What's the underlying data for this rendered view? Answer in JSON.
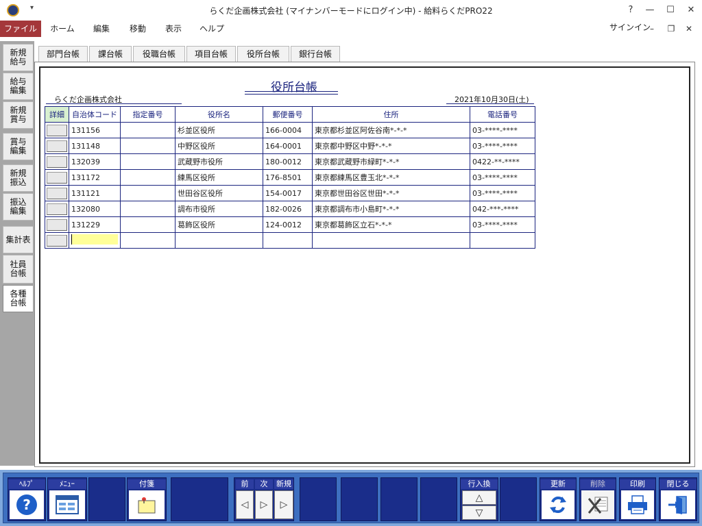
{
  "window": {
    "title": "らくだ企画株式会社 (マイナンバーモードにログイン中) - 給料らくだPRO22",
    "qa_dropdown": "▾",
    "help": "?",
    "minimize": "—",
    "maximize": "☐",
    "close": "✕"
  },
  "menubar": {
    "items": [
      "ファイル",
      "ホーム",
      "編集",
      "移動",
      "表示",
      "ヘルプ"
    ],
    "signin": "サインイン",
    "minimize": "–",
    "restore": "❐",
    "close": "✕"
  },
  "left_tabs": [
    "新規給与",
    "給与編集",
    "新規賞与",
    "賞与編集",
    "新規振込",
    "振込編集",
    "集計表",
    "社員台帳",
    "各種台帳"
  ],
  "top_tabs": [
    "部門台帳",
    "課台帳",
    "役職台帳",
    "項目台帳",
    "役所台帳",
    "銀行台帳"
  ],
  "report": {
    "title": "役所台帳",
    "company": "らくだ企画株式会社",
    "date": "2021年10月30日(土)"
  },
  "table": {
    "headers": [
      "詳細",
      "自治体コード",
      "指定番号",
      "役所名",
      "郵便番号",
      "住所",
      "電話番号"
    ],
    "rows": [
      {
        "code": "131156",
        "designation": "",
        "office": "杉並区役所",
        "postal": "166-0004",
        "address": "東京都杉並区阿佐谷南*-*-*",
        "phone": "03-****-****"
      },
      {
        "code": "131148",
        "designation": "",
        "office": "中野区役所",
        "postal": "164-0001",
        "address": "東京都中野区中野*-*-*",
        "phone": "03-****-****"
      },
      {
        "code": "132039",
        "designation": "",
        "office": "武蔵野市役所",
        "postal": "180-0012",
        "address": "東京都武蔵野市緑町*-*-*",
        "phone": "0422-**-****"
      },
      {
        "code": "131172",
        "designation": "",
        "office": "練馬区役所",
        "postal": "176-8501",
        "address": "東京都練馬区豊玉北*-*-*",
        "phone": "03-****-****"
      },
      {
        "code": "131121",
        "designation": "",
        "office": "世田谷区役所",
        "postal": "154-0017",
        "address": "東京都世田谷区世田*-*-*",
        "phone": "03-****-****"
      },
      {
        "code": "132080",
        "designation": "",
        "office": "調布市役所",
        "postal": "182-0026",
        "address": "東京都調布市小島町*-*-*",
        "phone": "042-***-****"
      },
      {
        "code": "131229",
        "designation": "",
        "office": "葛飾区役所",
        "postal": "124-0012",
        "address": "東京都葛飾区立石*-*-*",
        "phone": "03-****-****"
      }
    ]
  },
  "toolbar": {
    "help": "ﾍﾙﾌﾟ",
    "menu": "ﾒﾆｭｰ",
    "sticky": "付箋",
    "prev": "前",
    "next": "次",
    "new": "新規",
    "row_swap": "行入換",
    "refresh": "更新",
    "delete": "削除",
    "print": "印刷",
    "close": "閉じる",
    "help_glyph": "?",
    "prev_glyph": "◁",
    "next_glyph": "▷",
    "new_glyph": "▷",
    "up_glyph": "△",
    "down_glyph": "▽"
  },
  "colors": {
    "file_menu": "#a4373a",
    "toolbar_bg": "#3d6fc0",
    "fkey_bg": "#1a2d8a",
    "table_border": "#1a237e",
    "input_highlight": "#ffff99",
    "detail_header": "#d8f0d0"
  }
}
